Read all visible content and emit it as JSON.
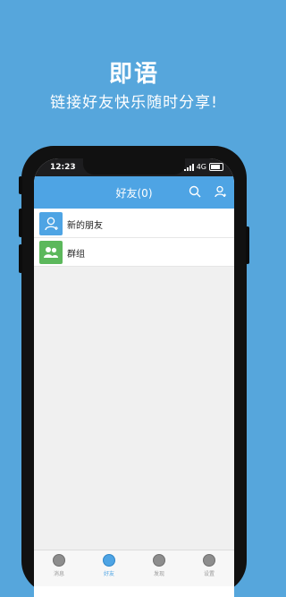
{
  "promo": {
    "title": "即语",
    "subtitle": "链接好友快乐随时分享!"
  },
  "status_bar": {
    "time": "12:23",
    "network": "4G"
  },
  "navbar": {
    "title": "好友(0)",
    "left_icon": "search-icon",
    "right_icon": "add-user-icon"
  },
  "list": {
    "items": [
      {
        "label": "新的朋友",
        "icon": "new-friend-icon",
        "color": "#4ea4e4"
      },
      {
        "label": "群组",
        "icon": "group-icon",
        "color": "#5cb85c"
      }
    ]
  },
  "tabbar": {
    "tabs": [
      {
        "label": "消息",
        "icon": "message-icon"
      },
      {
        "label": "好友",
        "icon": "friends-icon",
        "active": true
      },
      {
        "label": "发现",
        "icon": "discover-icon"
      },
      {
        "label": "设置",
        "icon": "settings-icon"
      }
    ]
  },
  "colors": {
    "background": "#56a6dc",
    "accent": "#4ea4e4",
    "group_green": "#5cb85c"
  }
}
